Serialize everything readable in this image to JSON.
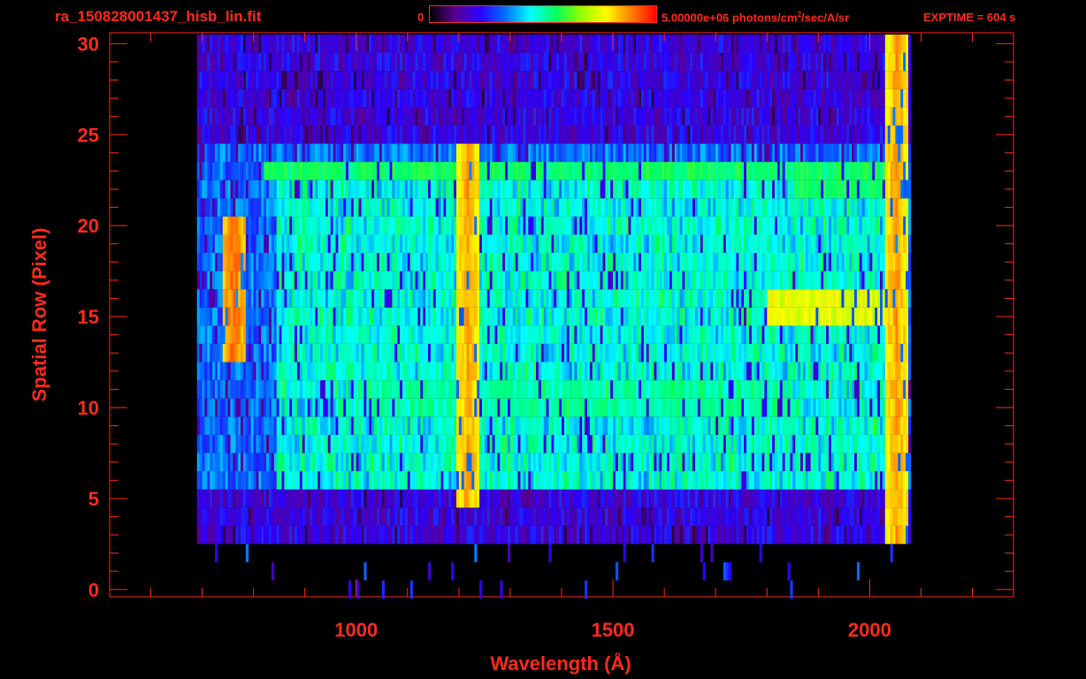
{
  "header": {
    "title": "ra_150828001437_hisb_lin.fit",
    "colorbar_min": "0",
    "colorbar_max_value": "5.00000e+06 photons/cm",
    "colorbar_max_exp": "2",
    "colorbar_max_tail": "/sec/A/sr",
    "exptime": "EXPTIME = 604 s",
    "colormap": [
      "#000000",
      "#5a0090",
      "#2a00ff",
      "#0070ff",
      "#00ffff",
      "#00ff60",
      "#90ff00",
      "#ffff00",
      "#ff8000",
      "#ff0000"
    ]
  },
  "chart_data": {
    "type": "heatmap",
    "title": "ra_150828001437_hisb_lin.fit",
    "xlabel": "Wavelength (Å)",
    "ylabel": "Spatial Row (Pixel)",
    "xlim": [
      520,
      2280
    ],
    "ylim": [
      -0.4,
      30.6
    ],
    "x_ticks": [
      1000,
      1500,
      2000
    ],
    "x_minor_step": 100,
    "y_ticks": [
      0,
      5,
      10,
      15,
      20,
      25,
      30
    ],
    "y_minor_step": 1,
    "grid": false,
    "color_range": [
      0,
      5000000
    ],
    "color_units": "photons/cm^2/sec/A/sr",
    "bright_features": [
      {
        "wavelength": 1216,
        "rows": [
          5,
          24
        ],
        "level": 0.9
      },
      {
        "wavelength": 760,
        "rows": [
          13,
          20
        ],
        "level": 0.95
      },
      {
        "wavelength": 1030,
        "rows": [
          7,
          23
        ],
        "level": 0.45
      },
      {
        "wavelength": 1800,
        "rows": [
          6,
          23
        ],
        "level": 0.5
      },
      {
        "wavelength": 2050,
        "rows": [
          1,
          30
        ],
        "level": 0.9
      }
    ],
    "bright_rows": [
      {
        "row": 10.5,
        "wavelength": [
          1000,
          1800
        ],
        "level": 0.55
      },
      {
        "row": 15.5,
        "wavelength": [
          1800,
          2050
        ],
        "level": 0.8
      },
      {
        "row": 23,
        "wavelength": [
          820,
          2050
        ],
        "level": 0.6
      },
      {
        "row": 22,
        "wavelength": [
          1850,
          2050
        ],
        "level": 0.6
      }
    ],
    "signal_region": {
      "wavelength": [
        690,
        2080
      ],
      "rows": [
        3,
        30
      ]
    }
  }
}
